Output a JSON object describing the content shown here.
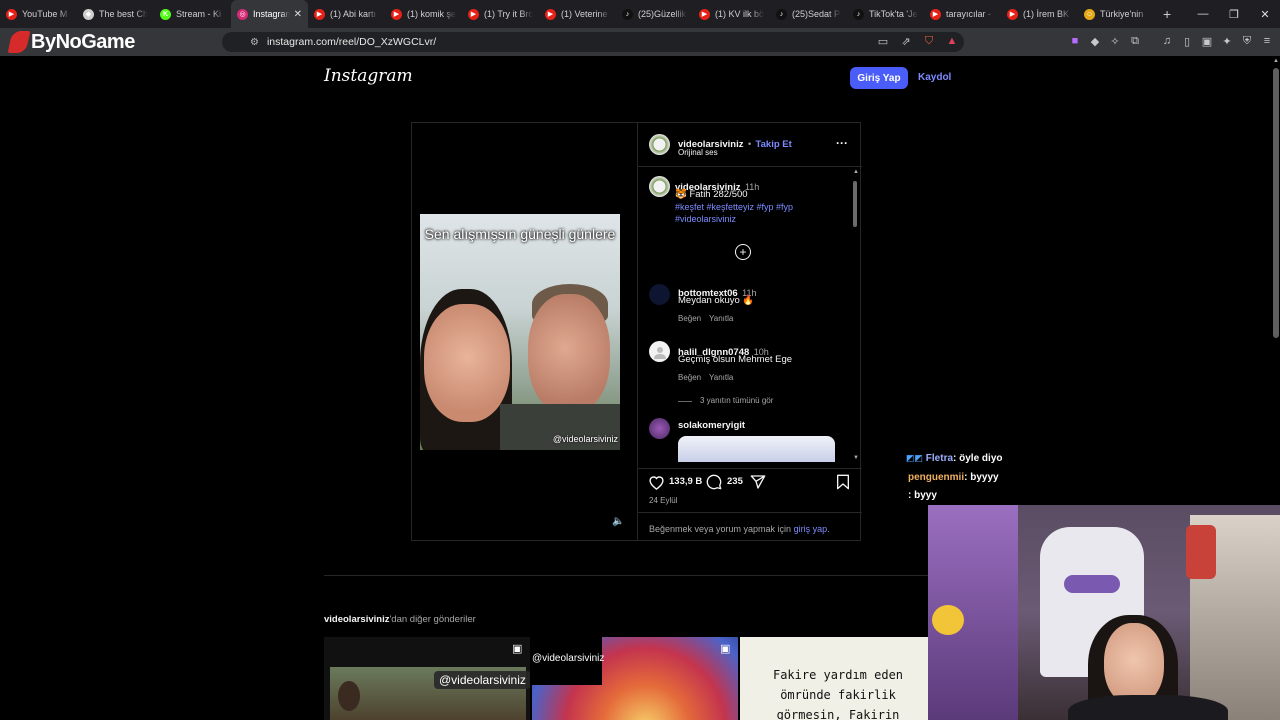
{
  "tabs": [
    {
      "label": "YouTube M",
      "fav_color": "#e62117",
      "fav_glyph": "▶"
    },
    {
      "label": "The best Ch",
      "fav_color": "#cfcfcf",
      "fav_glyph": "◆"
    },
    {
      "label": "Stream - Ki",
      "fav_color": "#53fc18",
      "fav_glyph": "K"
    },
    {
      "label": "Instagram",
      "fav_color": "#d62976",
      "fav_glyph": "◎",
      "active": true
    },
    {
      "label": "(1) Abi kartı",
      "fav_color": "#e62117",
      "fav_glyph": "▶"
    },
    {
      "label": "(1) komik şe",
      "fav_color": "#e62117",
      "fav_glyph": "▶"
    },
    {
      "label": "(1) Try it Bro",
      "fav_color": "#e62117",
      "fav_glyph": "▶"
    },
    {
      "label": "(1) Veterine",
      "fav_color": "#e62117",
      "fav_glyph": "▶"
    },
    {
      "label": "(25)Güzellik",
      "fav_color": "#111111",
      "fav_glyph": "♪"
    },
    {
      "label": "(1) KV ilk bö",
      "fav_color": "#e62117",
      "fav_glyph": "▶"
    },
    {
      "label": "(25)Sedat Pe",
      "fav_color": "#111111",
      "fav_glyph": "♪"
    },
    {
      "label": "TikTok'ta 'Je",
      "fav_color": "#111111",
      "fav_glyph": "♪"
    },
    {
      "label": "tarayıcılar -",
      "fav_color": "#e62117",
      "fav_glyph": "▶"
    },
    {
      "label": "(1) İrem BK",
      "fav_color": "#e62117",
      "fav_glyph": "▶"
    },
    {
      "label": "Türkiye'nin",
      "fav_color": "#e6a817",
      "fav_glyph": "☺"
    }
  ],
  "browser": {
    "logo_text": "ByNoGame",
    "url": "instagram.com/reel/DO_XzWGCLvr/"
  },
  "instagram": {
    "logo": "Instagram",
    "login_label": "Giriş Yap",
    "signup_label": "Kaydol",
    "header": {
      "username": "videolarsiviniz",
      "dot": "•",
      "follow_label": "Takip Et",
      "audio": "Orijinal ses",
      "more": "···"
    },
    "video": {
      "caption_overlay": "Sen alışmışsın güneşli günlere",
      "watermark": "@videolarsiviniz"
    },
    "caption": {
      "username": "videolarsiviniz",
      "time": "11h",
      "text": "🐯 Fatih 282/500",
      "hashtags_line1": "#keşfet #keşfetteyiz #fyp #fyp",
      "hashtags_line2": "#videolarsiviniz"
    },
    "comments": [
      {
        "username": "bottomtext06",
        "time": "11h",
        "text": "Meydan okuyo 🔥",
        "like": "Beğen",
        "reply": "Yanıtla"
      },
      {
        "username": "halil_dlgnn0748",
        "time": "10h",
        "text": "Geçmiş olsun Mehmet Ege",
        "like": "Beğen",
        "reply": "Yanıtla"
      }
    ],
    "view_replies": "3 yanıtın tümünü gör",
    "last_commenter": "solakomeryigit",
    "likes": "133,9 B",
    "comment_count": "235",
    "date": "24 Eylül",
    "login_prompt_pre": "Beğenmek veya yorum yapmak için ",
    "login_prompt_link": "giriş yap",
    "login_prompt_post": ".",
    "more_posts_user": "videolarsiviniz",
    "more_posts_rest": "'dan diğer gönderiler",
    "thumbs": [
      {
        "overlay": "@videolarsiviniz"
      },
      {
        "overlay": "@videolarsiviniz"
      },
      {
        "overlay": "Fakire yardım eden ömründe fakirlik görmesin, Fakirin hakkını yiyen"
      }
    ]
  },
  "chat": [
    {
      "user": "Fletra",
      "msg": ": öyle diyo",
      "user_color": "#9ab0ff"
    },
    {
      "user": "penguenmii",
      "msg": ": byyyy",
      "user_color": "#f0b060"
    },
    {
      "user": "",
      "msg": ": byyy",
      "user_color": "#ffffff"
    }
  ],
  "colors": {
    "accent": "#4a5df9",
    "link": "#7c8cff"
  }
}
